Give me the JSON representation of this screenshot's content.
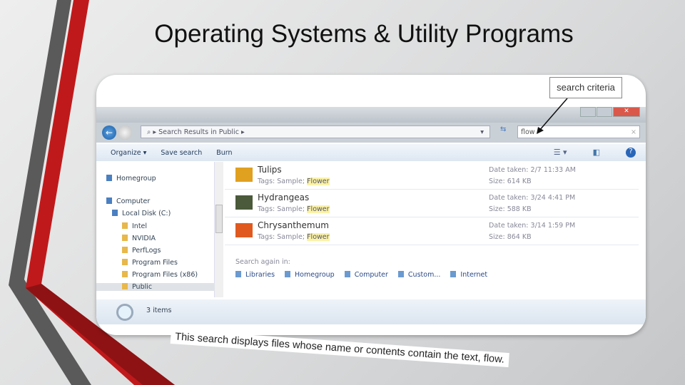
{
  "slide": {
    "title": "Operating Systems & Utility Programs",
    "caption": "This search displays files whose name or contents contain the text, flow.",
    "callout": "search criteria",
    "colors": {
      "stripe_red": "#c0191b",
      "stripe_gray": "#5a5a5a"
    }
  },
  "explorer": {
    "address": "Search Results in Public",
    "search_value": "flow",
    "toolbar": {
      "organize": "Organize ▾",
      "save_search": "Save search",
      "burn": "Burn"
    },
    "sidebar": [
      {
        "label": "Homegroup",
        "icon": "homegroup-icon"
      },
      {
        "label": "Computer",
        "icon": "computer-icon"
      },
      {
        "label": "Local Disk (C:)",
        "icon": "drive-icon"
      },
      {
        "label": "Intel",
        "icon": "folder-icon"
      },
      {
        "label": "NVIDIA",
        "icon": "folder-icon"
      },
      {
        "label": "PerfLogs",
        "icon": "folder-icon"
      },
      {
        "label": "Program Files",
        "icon": "folder-icon"
      },
      {
        "label": "Program Files (x86)",
        "icon": "folder-icon"
      },
      {
        "label": "Public",
        "icon": "folder-icon",
        "selected": true
      }
    ],
    "results": [
      {
        "name": "Tulips",
        "tags_label": "Tags: Sample; ",
        "tag": "Flower",
        "date": "Date taken: 2/7  11:33 AM",
        "size": "Size: 614 KB",
        "color": "#e0a020"
      },
      {
        "name": "Hydrangeas",
        "tags_label": "Tags: Sample; ",
        "tag": "Flower",
        "date": "Date taken: 3/24  4:41 PM",
        "size": "Size: 588 KB",
        "color": "#4a5a3a"
      },
      {
        "name": "Chrysanthemum",
        "tags_label": "Tags: Sample; ",
        "tag": "Flower",
        "date": "Date taken: 3/14  1:59 PM",
        "size": "Size: 864 KB",
        "color": "#e05a20"
      }
    ],
    "search_again_label": "Search again in:",
    "search_again": [
      "Libraries",
      "Homegroup",
      "Computer",
      "Custom...",
      "Internet"
    ],
    "status": "3 items"
  }
}
